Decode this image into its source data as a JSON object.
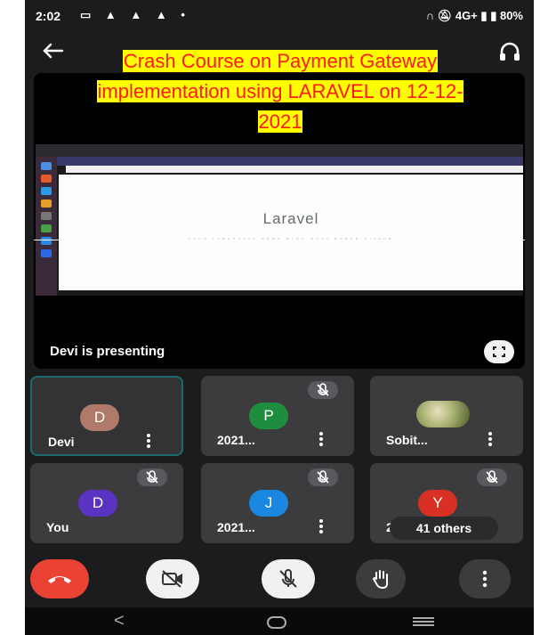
{
  "status_bar": {
    "time": "2:02",
    "notification_icons": "▭ ▲ ▲ ▲ •",
    "network": "4G+",
    "battery": "80%"
  },
  "title_overlay": {
    "line1": "Crash Course on Payment  Gateway",
    "line2": "implementation using LARAVEL on  12-12-",
    "line3": "2021"
  },
  "shared_screen": {
    "page_heading": "Laravel",
    "page_links": "DOCS   LARACASTS   NEWS   BLOG   NOVA   FORGE   GITHUB"
  },
  "presenter_label": "Devi is presenting",
  "participants": [
    {
      "initial": "D",
      "name": "Devi",
      "color": "#b07a6a",
      "muted": false
    },
    {
      "initial": "P",
      "name": "2021...",
      "color": "#1e8e3e",
      "muted": true
    },
    {
      "initial": "",
      "name": "Sobit...",
      "color": "",
      "muted": false
    },
    {
      "initial": "D",
      "name": "You",
      "color": "#5a33c2",
      "muted": true
    },
    {
      "initial": "J",
      "name": "2021...",
      "color": "#1a88e0",
      "muted": true
    },
    {
      "initial": "Y",
      "name": "20",
      "color": "#d93025",
      "muted": true
    }
  ],
  "others_count": "41 others",
  "colors": {
    "end_call": "#ea4335",
    "title_text": "#ff1a1a",
    "title_highlight": "#ffff00",
    "active_tile_border": "#1c6b6b"
  },
  "nav": {
    "back": "<"
  }
}
